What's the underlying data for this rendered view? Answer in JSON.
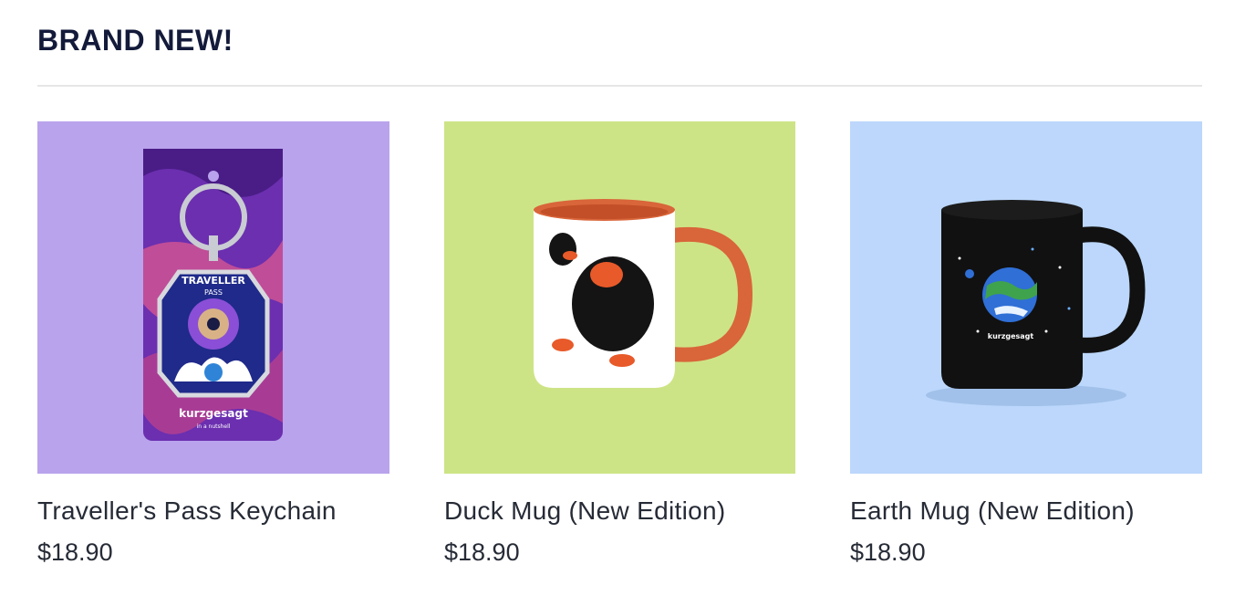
{
  "section": {
    "title": "BRAND NEW!"
  },
  "products": [
    {
      "name": "Traveller's Pass Keychain",
      "price": "$18.90",
      "bg_color": "#b9a3ec",
      "image_text": {
        "pass_title": "TRAVELLER",
        "pass_sub": "PASS",
        "brand": "kurzgesagt",
        "tagline": "in a nutshell"
      }
    },
    {
      "name": "Duck Mug (New Edition)",
      "price": "$18.90",
      "bg_color": "#cde486"
    },
    {
      "name": "Earth Mug (New Edition)",
      "price": "$18.90",
      "bg_color": "#bcd7fb",
      "image_text": {
        "brand": "kurzgesagt"
      }
    }
  ]
}
